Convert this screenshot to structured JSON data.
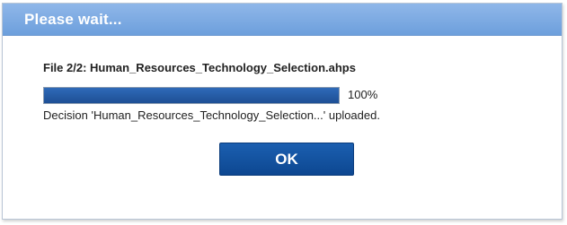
{
  "dialog": {
    "title": "Please wait...",
    "file_label": "File 2/2: Human_Resources_Technology_Selection.ahps",
    "progress": {
      "value_percent": 100,
      "text": "100%"
    },
    "status": "Decision 'Human_Resources_Technology_Selection...' uploaded.",
    "ok_label": "OK"
  },
  "colors": {
    "titlebar": "#7aa8e2",
    "progress_fill": "#1e4f95",
    "button": "#0d4791"
  }
}
